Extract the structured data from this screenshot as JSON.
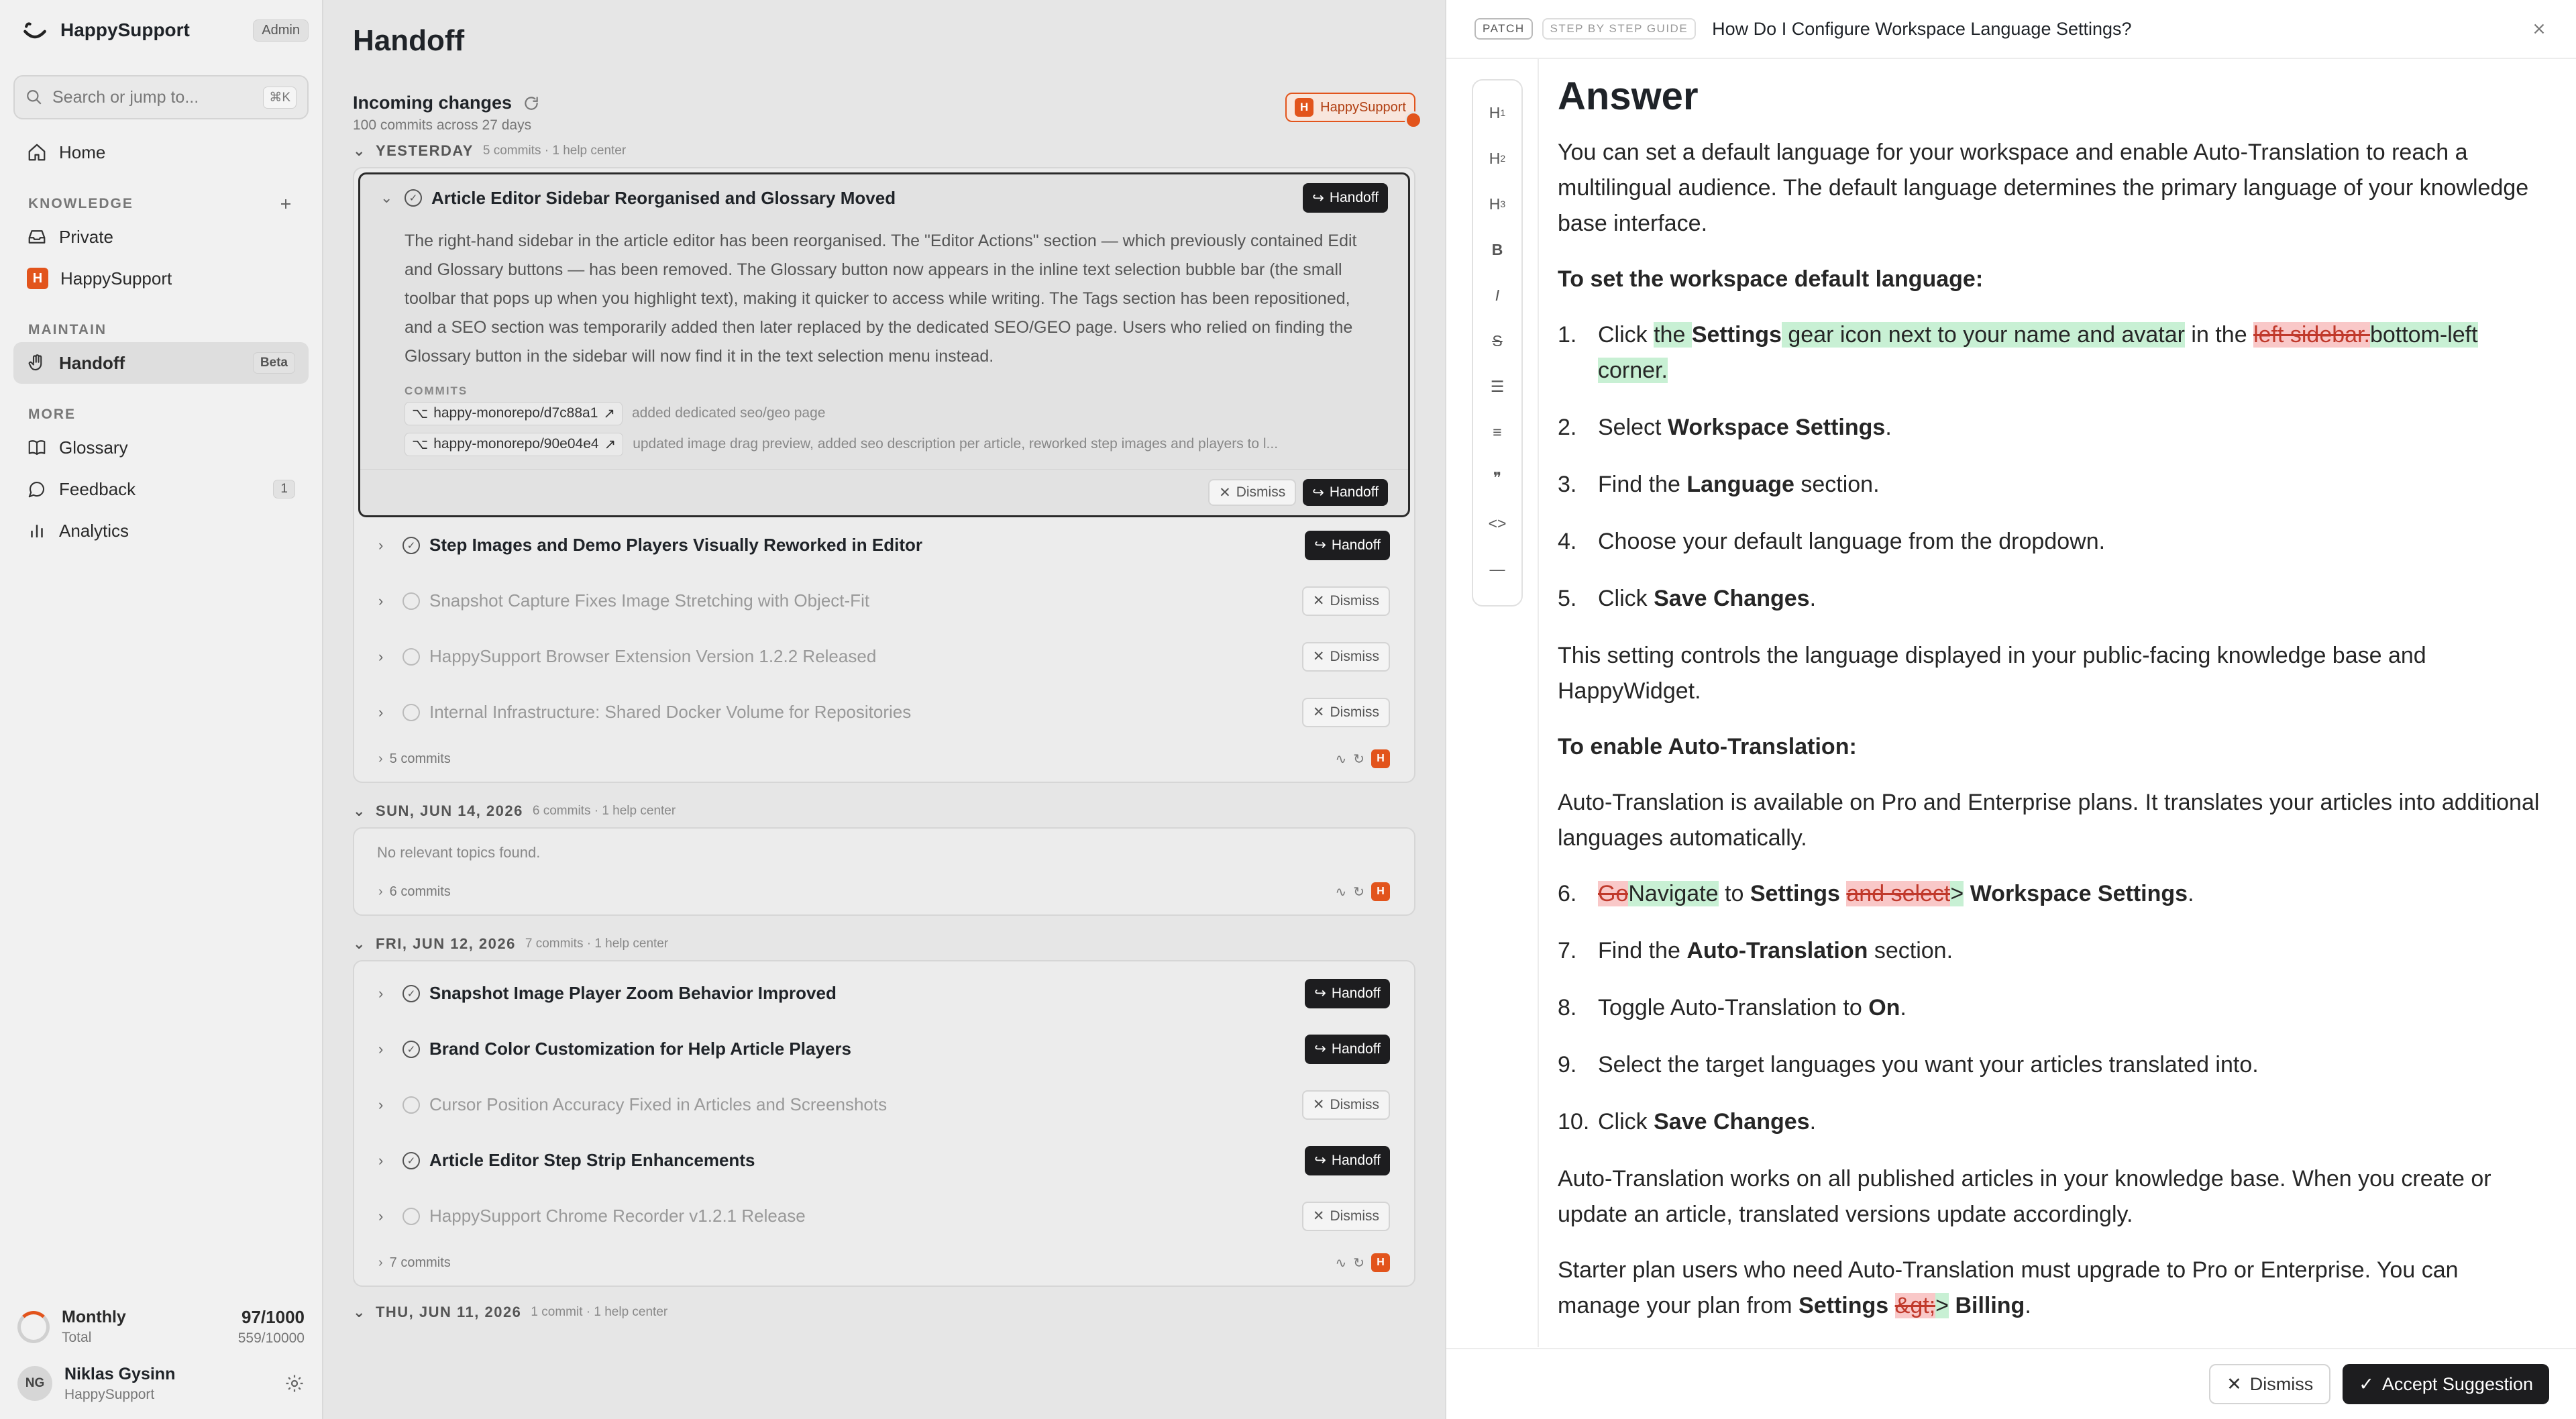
{
  "sidebar": {
    "brand": "HappySupport",
    "role_badge": "Admin",
    "search_placeholder": "Search or jump to...",
    "search_shortcut": "⌘K",
    "home": "Home",
    "knowledge_label": "KNOWLEDGE",
    "private": "Private",
    "happysupport": "HappySupport",
    "maintain_label": "MAINTAIN",
    "handoff": "Handoff",
    "handoff_badge": "Beta",
    "more_label": "MORE",
    "glossary": "Glossary",
    "feedback": "Feedback",
    "feedback_count": "1",
    "analytics": "Analytics",
    "usage": {
      "label": "Monthly",
      "sub": "Total",
      "value": "97/1000",
      "total": "559/10000"
    },
    "user": {
      "initials": "NG",
      "name": "Niklas Gysinn",
      "org": "HappySupport"
    }
  },
  "main": {
    "title": "Handoff",
    "incoming_title": "Incoming changes",
    "incoming_sub": "100 commits across 27 days",
    "pill_label": "HappySupport",
    "pill_letter": "H",
    "handoff_label": "Handoff",
    "dismiss_label": "Dismiss",
    "days": [
      {
        "label": "YESTERDAY",
        "meta": "5 commits · 1 help center",
        "expanded": {
          "title": "Article Editor Sidebar Reorganised and Glossary Moved",
          "body": "The right-hand sidebar in the article editor has been reorganised. The \"Editor Actions\" section — which previously contained Edit and Glossary buttons — has been removed. The Glossary button now appears in the inline text selection bubble bar (the small toolbar that pops up when you highlight text), making it quicker to access while writing. The Tags section has been repositioned, and a SEO section was temporarily added then later replaced by the dedicated SEO/GEO page. Users who relied on finding the Glossary button in the sidebar will now find it in the text selection menu instead.",
          "commits_label": "COMMITS",
          "commits": [
            {
              "repo": "happy-monorepo/d7c88a1",
              "msg": "added dedicated seo/geo page"
            },
            {
              "repo": "happy-monorepo/90e04e4",
              "msg": "updated image drag preview, added seo description per article, reworked step images and players to l..."
            }
          ]
        },
        "rows": [
          {
            "title": "Step Images and Demo Players Visually Reworked in Editor",
            "muted": false
          },
          {
            "title": "Snapshot Capture Fixes Image Stretching with Object-Fit",
            "muted": true
          },
          {
            "title": "HappySupport Browser Extension Version 1.2.2 Released",
            "muted": true
          },
          {
            "title": "Internal Infrastructure: Shared Docker Volume for Repositories",
            "muted": true
          }
        ],
        "footer": "5 commits"
      },
      {
        "label": "SUN, JUN 14, 2026",
        "meta": "6 commits · 1 help center",
        "empty": "No relevant topics found.",
        "footer": "6 commits"
      },
      {
        "label": "FRI, JUN 12, 2026",
        "meta": "7 commits · 1 help center",
        "rows": [
          {
            "title": "Snapshot Image Player Zoom Behavior Improved",
            "muted": false
          },
          {
            "title": "Brand Color Customization for Help Article Players",
            "muted": false
          },
          {
            "title": "Cursor Position Accuracy Fixed in Articles and Screenshots",
            "muted": true
          },
          {
            "title": "Article Editor Step Strip Enhancements",
            "muted": false
          },
          {
            "title": "HappySupport Chrome Recorder v1.2.1 Release",
            "muted": true
          }
        ],
        "footer": "7 commits"
      },
      {
        "label": "THU, JUN 11, 2026",
        "meta": "1 commit · 1 help center"
      }
    ]
  },
  "panel": {
    "tag1": "PATCH",
    "tag2": "STEP BY STEP GUIDE",
    "title": "How Do I Configure Workspace Language Settings?",
    "heading": "Answer",
    "intro": "You can set a default language for your workspace and enable Auto-Translation to reach a multilingual audience. The default language determines the primary language of your knowledge base interface.",
    "set_heading": "To set the workspace default language:",
    "step1": {
      "n": "1.",
      "a": "Click ",
      "ins1": "the ",
      "b": "Settings",
      "ins2": " gear icon next to your name and avatar",
      "c": " in the ",
      "del": "left sidebar.",
      "ins3": "bottom-left corner."
    },
    "step2": {
      "n": "2.",
      "a": "Select ",
      "b": "Workspace Settings",
      "c": "."
    },
    "step3": {
      "n": "3.",
      "a": "Find the ",
      "b": "Language",
      "c": " section."
    },
    "step4": {
      "n": "4.",
      "a": "Choose your default language from the dropdown."
    },
    "step5": {
      "n": "5.",
      "a": "Click ",
      "b": "Save Changes",
      "c": "."
    },
    "para2": "This setting controls the language displayed in your public-facing knowledge base and HappyWidget.",
    "auto_heading": "To enable Auto-Translation:",
    "para3": "Auto-Translation is available on Pro and Enterprise plans. It translates your articles into additional languages automatically.",
    "step6": {
      "n": "6.",
      "del1": "Go",
      "ins1": "Navigate",
      "a": " to ",
      "b": "Settings",
      "sp": " ",
      "del2": "and select",
      "ins2": ">",
      "c": " Workspace Settings",
      "d": "."
    },
    "step7": {
      "n": "7.",
      "a": "Find the ",
      "b": "Auto-Translation",
      "c": " section."
    },
    "step8": {
      "n": "8.",
      "a": "Toggle Auto-Translation to ",
      "b": "On",
      "c": "."
    },
    "step9": {
      "n": "9.",
      "a": "Select the target languages you want your articles translated into."
    },
    "step10": {
      "n": "10.",
      "a": "Click ",
      "b": "Save Changes",
      "c": "."
    },
    "para4": "Auto-Translation works on all published articles in your knowledge base. When you create or update an article, translated versions update accordingly.",
    "para5a": "Starter plan users who need Auto-Translation must upgrade to Pro or Enterprise. You can manage your plan from ",
    "para5b": "Settings",
    "para5sp": " ",
    "para5del": "&gt;",
    "para5ins": ">",
    "para5c": " Billing",
    "para5d": ".",
    "dismiss": "Dismiss",
    "accept": "Accept Suggestion"
  }
}
